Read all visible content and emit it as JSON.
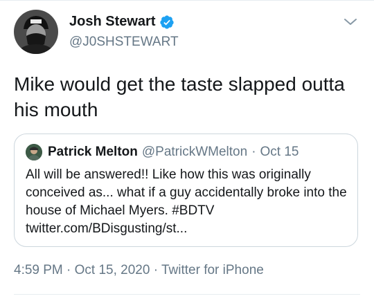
{
  "author": {
    "display_name": "Josh Stewart",
    "handle": "@J0SHSTEWART",
    "verified": true
  },
  "tweet": {
    "text": "Mike would get the taste slapped outta his mouth"
  },
  "quoted": {
    "display_name": "Patrick Melton",
    "handle": "@PatrickWMelton",
    "separator": "·",
    "date": "Oct 15",
    "text": "All will be answered!! Like how this was originally conceived as... what if a guy accidentally broke into the house of Michael Myers. #BDTV twitter.com/BDisgusting/st..."
  },
  "meta": {
    "timestamp": "4:59 PM · Oct 15, 2020 · Twitter for iPhone"
  },
  "colors": {
    "text": "#14171a",
    "secondary": "#657786",
    "verified": "#1da1f2",
    "border": "#ccd6dd"
  },
  "icons": {
    "verified": "verified-badge-icon",
    "menu": "chevron-down-icon"
  }
}
